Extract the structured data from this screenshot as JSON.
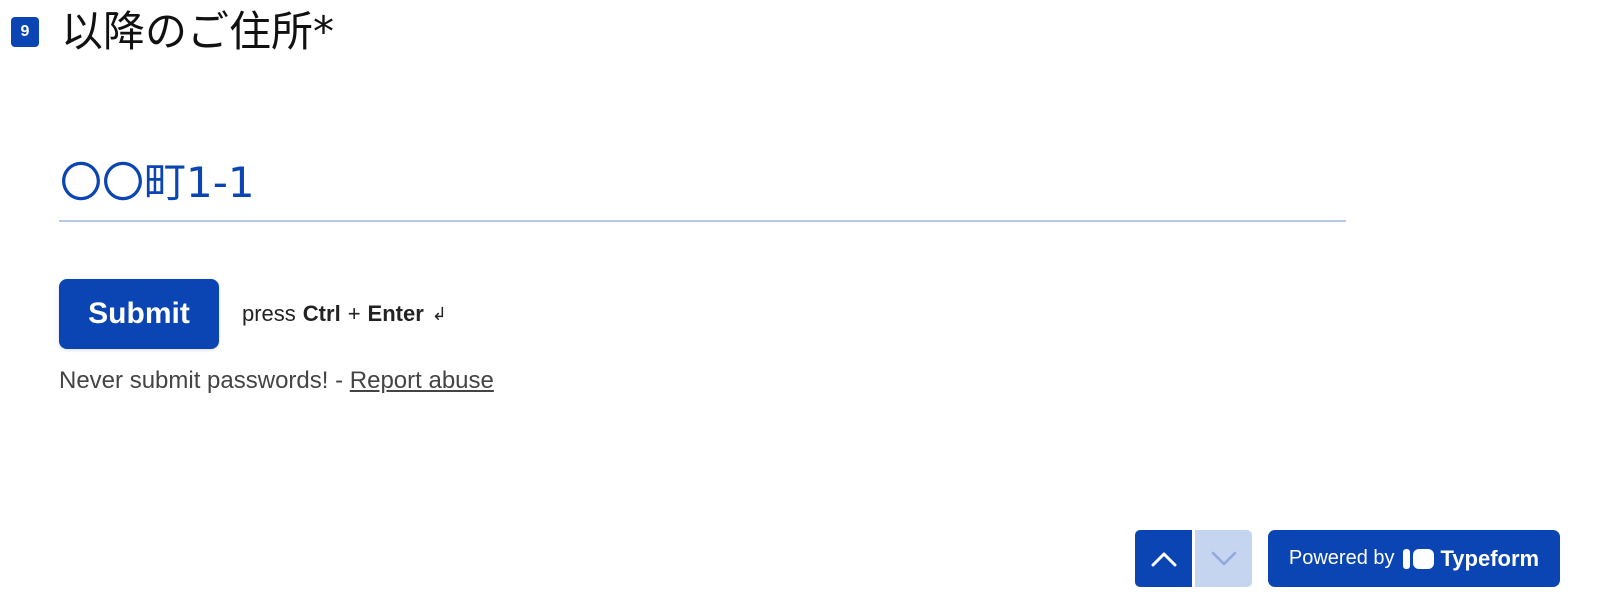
{
  "question": {
    "number": "9",
    "title": "以降のご住所*"
  },
  "answer": {
    "value": "〇〇町1-1"
  },
  "submit": {
    "label": "Submit",
    "hint_prefix": "press",
    "hint_key1": "Ctrl",
    "hint_plus": "+",
    "hint_key2": "Enter",
    "hint_icon": "↲"
  },
  "footer": {
    "warning_text": "Never submit passwords! - ",
    "report_link": "Report abuse"
  },
  "navigation": {
    "up_icon": "chevron-up-icon",
    "down_icon": "chevron-down-icon"
  },
  "powered_by": {
    "label": "Powered by",
    "brand": "Typeform"
  },
  "colors": {
    "accent": "#0a45b3",
    "accent_light": "#c5d4ef",
    "underline": "#b8c9e8"
  }
}
